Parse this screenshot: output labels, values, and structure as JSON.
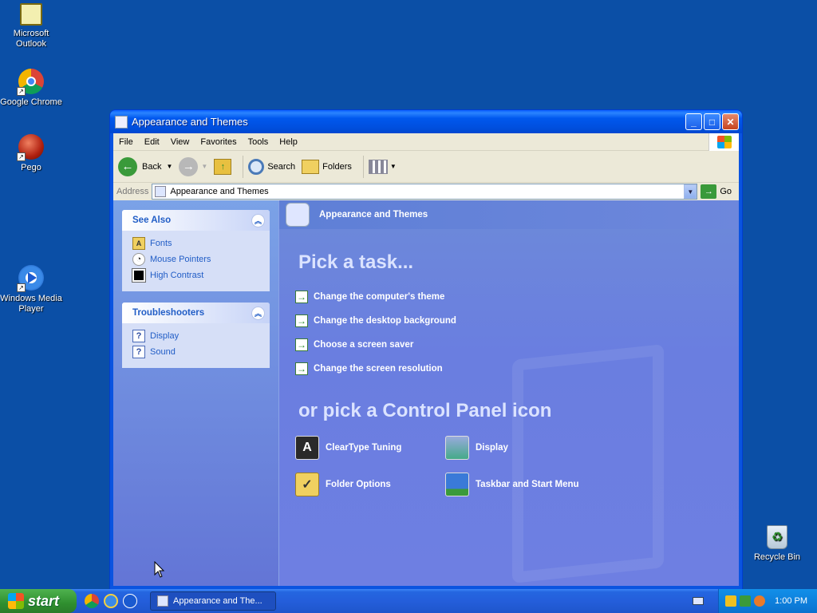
{
  "desktop": {
    "icons": [
      {
        "label": "Microsoft Outlook",
        "icon": "outlook-icon"
      },
      {
        "label": "Google Chrome",
        "icon": "chrome-icon"
      },
      {
        "label": "Pego",
        "icon": "pego-icon"
      },
      {
        "label": "Windows Media Player",
        "icon": "media-player-icon"
      },
      {
        "label": "Recycle Bin",
        "icon": "recycle-bin-icon"
      }
    ]
  },
  "window": {
    "title": "Appearance and Themes",
    "menu": [
      "File",
      "Edit",
      "View",
      "Favorites",
      "Tools",
      "Help"
    ],
    "toolbar": {
      "back": "Back",
      "search": "Search",
      "folders": "Folders"
    },
    "address": {
      "label": "Address",
      "value": "Appearance and Themes",
      "go": "Go"
    },
    "see_also": {
      "title": "See Also",
      "links": [
        "Fonts",
        "Mouse Pointers",
        "High Contrast"
      ]
    },
    "troubleshooters": {
      "title": "Troubleshooters",
      "links": [
        "Display",
        "Sound"
      ]
    },
    "main": {
      "header": "Appearance and Themes",
      "pick_task": "Pick a task...",
      "tasks": [
        "Change the computer's theme",
        "Change the desktop background",
        "Choose a screen saver",
        "Change the screen resolution"
      ],
      "or_pick": "or pick a Control Panel icon",
      "icons": [
        "ClearType Tuning",
        "Display",
        "Folder Options",
        "Taskbar and Start Menu"
      ]
    }
  },
  "taskbar": {
    "start": "start",
    "active_task": "Appearance and The...",
    "clock": "1:00 PM"
  },
  "colors": {
    "desktop": "#0b4fa6",
    "titlebar": "#0058ee",
    "taskpane_link": "#215dc6",
    "start_button": "#3c9a3c"
  }
}
